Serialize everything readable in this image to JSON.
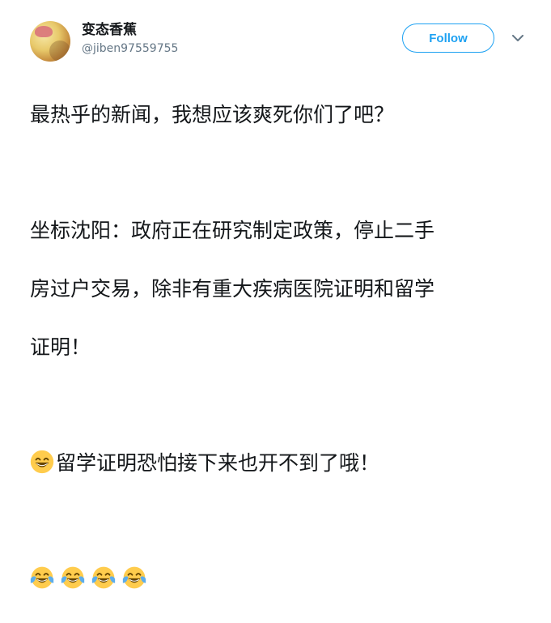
{
  "user": {
    "display_name": "变态香蕉",
    "handle": "@jiben97559755"
  },
  "actions": {
    "follow_label": "Follow"
  },
  "tweet": {
    "line1": "最热乎的新闻，我想应该爽死你们了吧？",
    "line2": "坐标沈阳：政府正在研究制定政策，停止二手",
    "line3": "房过户交易，除非有重大疾病医院证明和留学",
    "line4": "证明！",
    "line5_text": "留学证明恐怕接下来也开不到了哦！",
    "line5_emoji": "grinning-face",
    "line6_emojis": [
      "face-with-tears-of-joy",
      "face-with-tears-of-joy",
      "face-with-tears-of-joy",
      "face-with-tears-of-joy"
    ]
  },
  "colors": {
    "accent": "#1da1f2",
    "text": "#14171a",
    "secondary": "#657786"
  }
}
